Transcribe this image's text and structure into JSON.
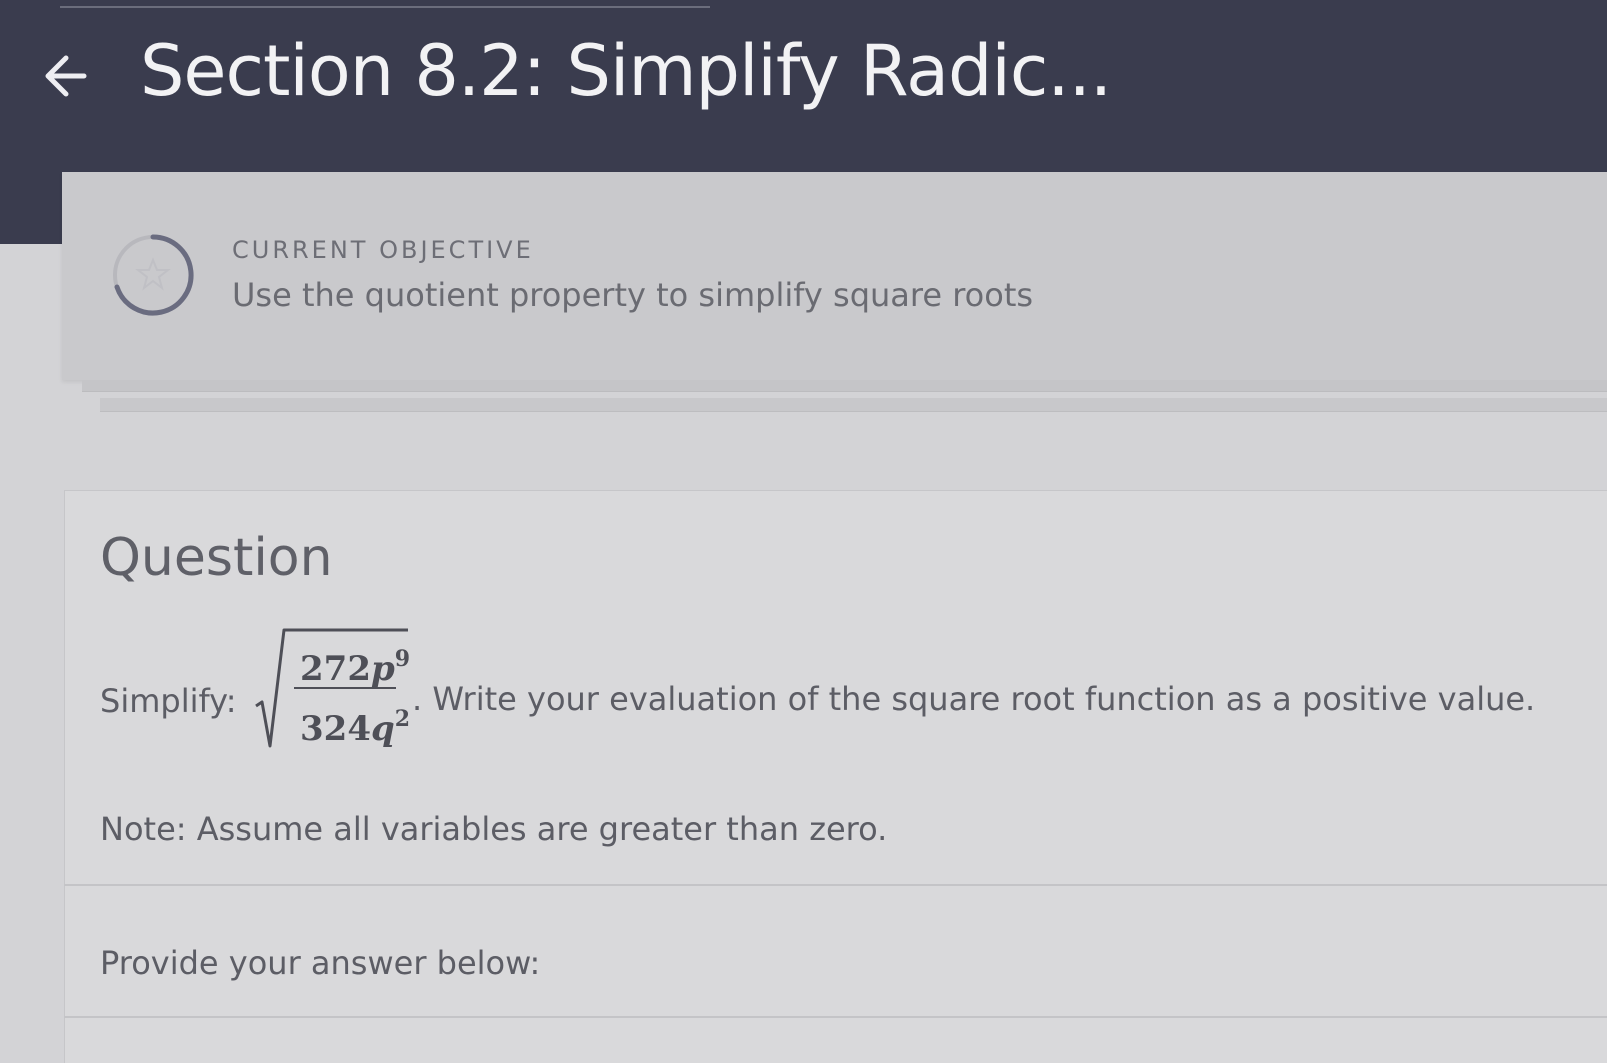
{
  "header": {
    "title": "Section 8.2: Simplify Radic...",
    "back_icon": "arrow-left-icon"
  },
  "objective": {
    "label": "CURRENT OBJECTIVE",
    "text": "Use the quotient property to simplify square roots",
    "icon": "star-progress-ring-icon"
  },
  "question": {
    "heading": "Question",
    "simplify_label": "Simplify:",
    "fraction": {
      "numerator_coef": "272",
      "numerator_var": "p",
      "numerator_exp": "9",
      "denominator_coef": "324",
      "denominator_var": "q",
      "denominator_exp": "2"
    },
    "instruction": ". Write your evaluation of the square root function as a positive value.",
    "note": "Note: Assume all variables are greater than zero.",
    "answer_prompt": "Provide your answer below:"
  },
  "colors": {
    "header_bg": "#3a3c4e",
    "page_bg": "#d3d3d6",
    "text": "#5c5d65"
  }
}
